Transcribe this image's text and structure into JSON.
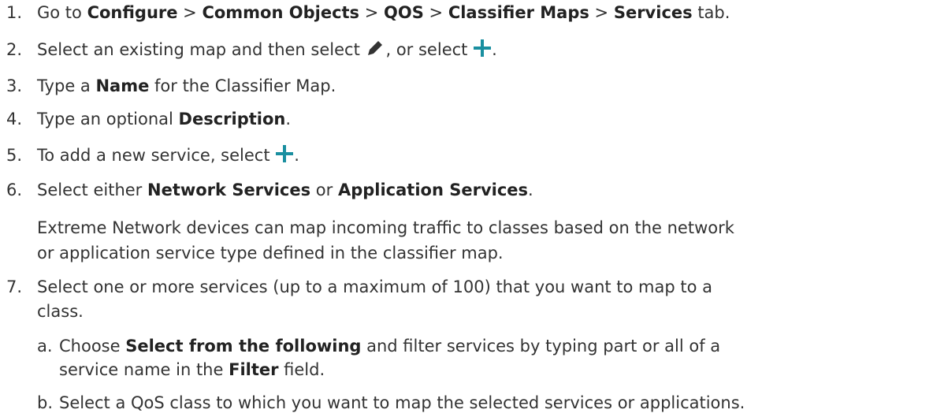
{
  "steps": {
    "s1": {
      "num": "1.",
      "t1": "Go to ",
      "b1": "Configure",
      "t2": " > ",
      "b2": "Common Objects",
      "t3": " > ",
      "b3": "QOS",
      "t4": " > ",
      "b4": "Classifier Maps",
      "t5": " > ",
      "b5": "Services",
      "t6": " tab."
    },
    "s2": {
      "num": "2.",
      "t1": "Select an existing map and then select ",
      "t2": ", or select ",
      "t3": ".",
      "edit_icon": "pencil-icon",
      "add_icon": "plus-icon"
    },
    "s3": {
      "num": "3.",
      "t1": "Type a ",
      "b1": "Name",
      "t2": " for the Classifier Map."
    },
    "s4": {
      "num": "4.",
      "t1": "Type an optional ",
      "b1": "Description",
      "t2": "."
    },
    "s5": {
      "num": "5.",
      "t1": "To add a new service, select ",
      "t2": ".",
      "add_icon": "plus-icon"
    },
    "s6": {
      "num": "6.",
      "t1": "Select either ",
      "b1": "Network Services",
      "t2": " or ",
      "b2": "Application Services",
      "t3": ".",
      "note_line1": "Extreme Network devices can map incoming traffic to classes based on the network",
      "note_line2": "or application service type defined in the classifier map."
    },
    "s7": {
      "num": "7.",
      "line1": "Select one or more services (up to a maximum of 100) that you want to map to a",
      "line2": "class.",
      "sub_a": {
        "num": "a.",
        "t1": "Choose ",
        "b1": "Select from the following",
        "t2": " and filter services by typing part or all of a",
        "t3": "service name in the ",
        "b2": "Filter",
        "t4": " field."
      },
      "sub_b": {
        "num": "b.",
        "t1": "Select a QoS class to which you want to map the selected services or applications."
      }
    }
  },
  "colors": {
    "text": "#333333",
    "icon_dark": "#333333",
    "icon_accent": "#1a8fa0"
  }
}
